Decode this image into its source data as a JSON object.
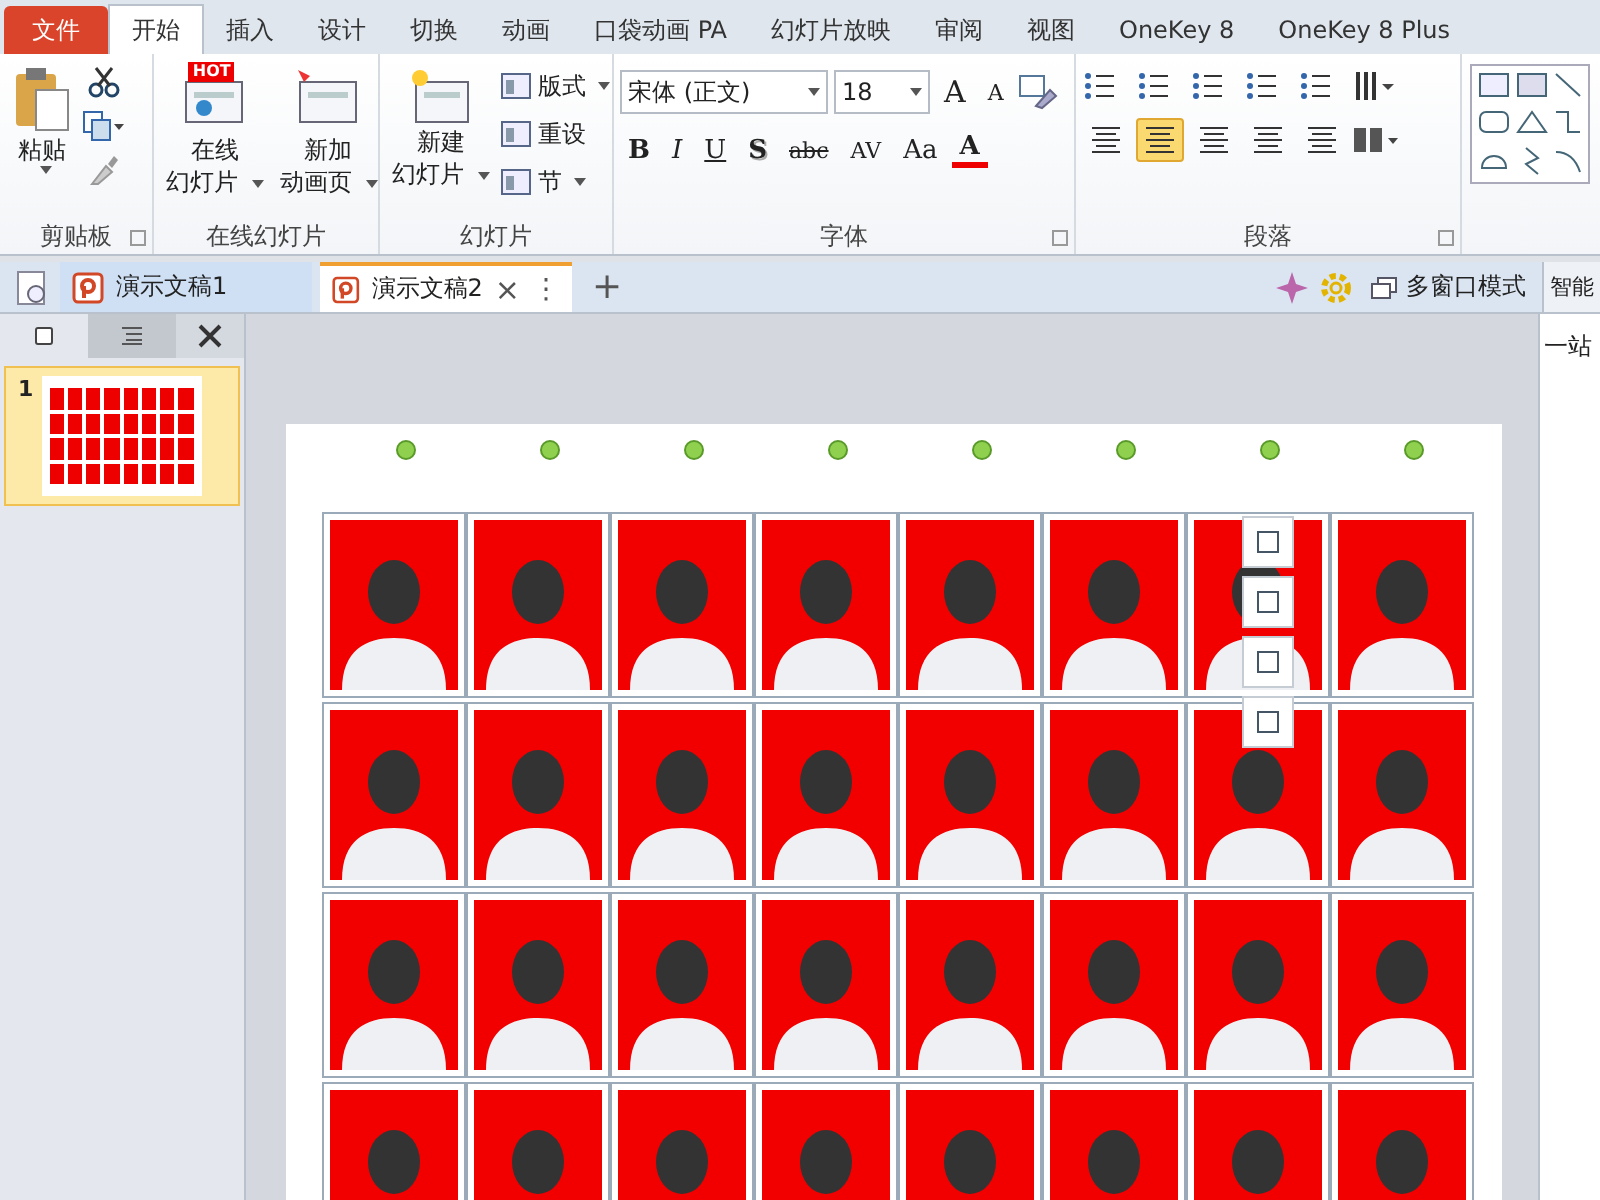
{
  "ribbon_tabs": [
    {
      "label": "文件",
      "kind": "file",
      "selected": false
    },
    {
      "label": "开始",
      "kind": "tab",
      "selected": true
    },
    {
      "label": "插入",
      "kind": "tab",
      "selected": false
    },
    {
      "label": "设计",
      "kind": "tab",
      "selected": false
    },
    {
      "label": "切换",
      "kind": "tab",
      "selected": false
    },
    {
      "label": "动画",
      "kind": "tab",
      "selected": false
    },
    {
      "label": "口袋动画 PA",
      "kind": "tab",
      "selected": false
    },
    {
      "label": "幻灯片放映",
      "kind": "tab",
      "selected": false
    },
    {
      "label": "审阅",
      "kind": "tab",
      "selected": false
    },
    {
      "label": "视图",
      "kind": "tab",
      "selected": false
    },
    {
      "label": "OneKey 8",
      "kind": "tab",
      "selected": false
    },
    {
      "label": "OneKey 8 Plus",
      "kind": "tab",
      "selected": false
    }
  ],
  "clipboard": {
    "label": "剪贴板",
    "paste": "粘贴"
  },
  "online_slides": {
    "label": "在线幻灯片",
    "buttons": [
      {
        "line1": "在线",
        "line2": "幻灯片",
        "badge": "HOT"
      },
      {
        "line1": "新加",
        "line2": "动画页"
      }
    ]
  },
  "slides": {
    "label": "幻灯片",
    "new_line1": "新建",
    "new_line2": "幻灯片",
    "small": [
      {
        "label": "版式",
        "dropdown": true
      },
      {
        "label": "重设",
        "dropdown": false
      },
      {
        "label": "节",
        "dropdown": true
      }
    ]
  },
  "font": {
    "label": "字体",
    "font_name": "宋体 (正文)",
    "font_size": "18",
    "grow": "A",
    "shrink": "A",
    "formats": [
      {
        "label": "B",
        "kind": "bold"
      },
      {
        "label": "I",
        "kind": "italic"
      },
      {
        "label": "U",
        "kind": "underline"
      },
      {
        "label": "S",
        "kind": "shadow"
      },
      {
        "label": "abc",
        "kind": "strike"
      },
      {
        "label": "AV",
        "kind": "spacing"
      },
      {
        "label": "Aa",
        "kind": "case"
      },
      {
        "label": "A",
        "kind": "color"
      }
    ]
  },
  "paragraph": {
    "label": "段落",
    "aligns": [
      {
        "selected": false
      },
      {
        "selected": true
      },
      {
        "selected": false
      },
      {
        "selected": false
      },
      {
        "selected": false
      }
    ]
  },
  "doc_tabs": [
    {
      "label": "演示文稿1",
      "selected": false
    },
    {
      "label": "演示文稿2",
      "selected": true
    }
  ],
  "doc_tab_close": "×",
  "doc_tab_menu": "⋮",
  "new_tab": "+",
  "multi_window": "多窗口模式",
  "side_panel": {
    "title": "智能",
    "text": "一站"
  },
  "slide_list": [
    {
      "number": "1",
      "selected": true
    }
  ]
}
